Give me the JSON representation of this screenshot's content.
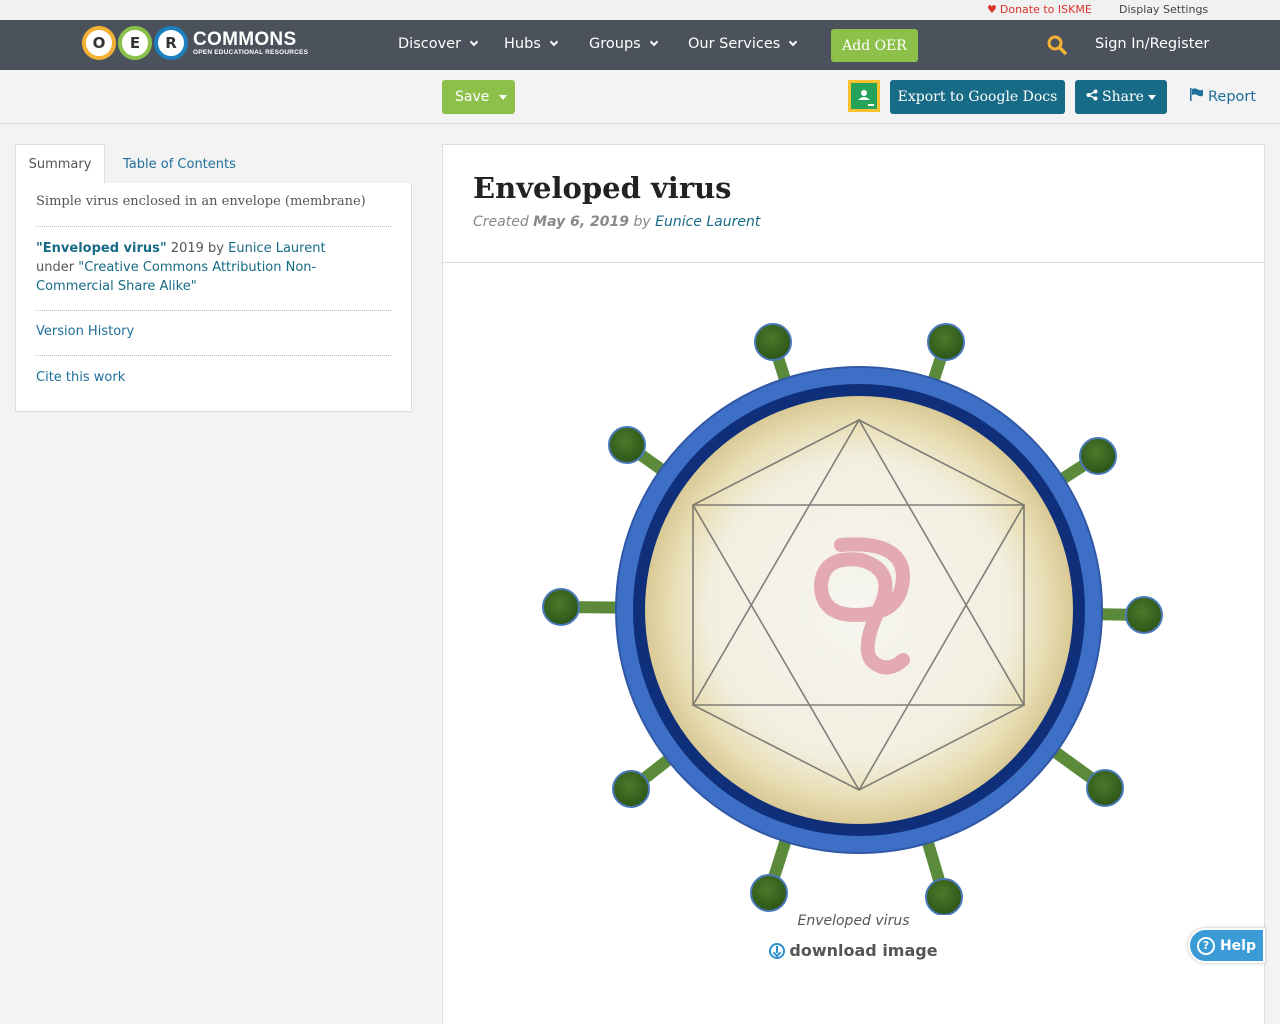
{
  "utility": {
    "donate_label": "Donate to ISKME",
    "display_settings_label": "Display Settings"
  },
  "nav": {
    "logo_letters": [
      "O",
      "E",
      "R"
    ],
    "logo_title": "COMMONS",
    "logo_subtitle": "OPEN EDUCATIONAL RESOURCES",
    "items": [
      {
        "label": "Discover"
      },
      {
        "label": "Hubs"
      },
      {
        "label": "Groups"
      },
      {
        "label": "Our Services"
      }
    ],
    "add_oer_label": "Add OER",
    "signin_label": "Sign In/Register"
  },
  "toolbar": {
    "save_label": "Save",
    "export_label": "Export to Google Docs",
    "share_label": "Share",
    "report_label": "Report"
  },
  "sidebar": {
    "tabs": [
      {
        "label": "Summary"
      },
      {
        "label": "Table of Contents"
      }
    ],
    "description": "Simple virus enclosed in an envelope (membrane)",
    "attribution": {
      "title": "\"Enveloped virus\"",
      "year": "2019",
      "by": "by",
      "author": "Eunice Laurent",
      "under": "under",
      "license": "\"Creative Commons Attribution Non-Commercial Share Alike\""
    },
    "version_history_label": "Version History",
    "cite_label": "Cite this work"
  },
  "main": {
    "title": "Enveloped virus",
    "created_prefix": "Created",
    "created_date": "May 6, 2019",
    "created_by": "by",
    "author": "Eunice Laurent",
    "image_caption": "Enveloped virus",
    "download_label": "download image"
  },
  "help": {
    "label": "Help"
  },
  "colors": {
    "nav_bg": "#4b525c",
    "green": "#8cc04b",
    "teal": "#176b87",
    "link": "#1f6f9b",
    "donate": "#d9332b",
    "help": "#3b9bd6"
  }
}
